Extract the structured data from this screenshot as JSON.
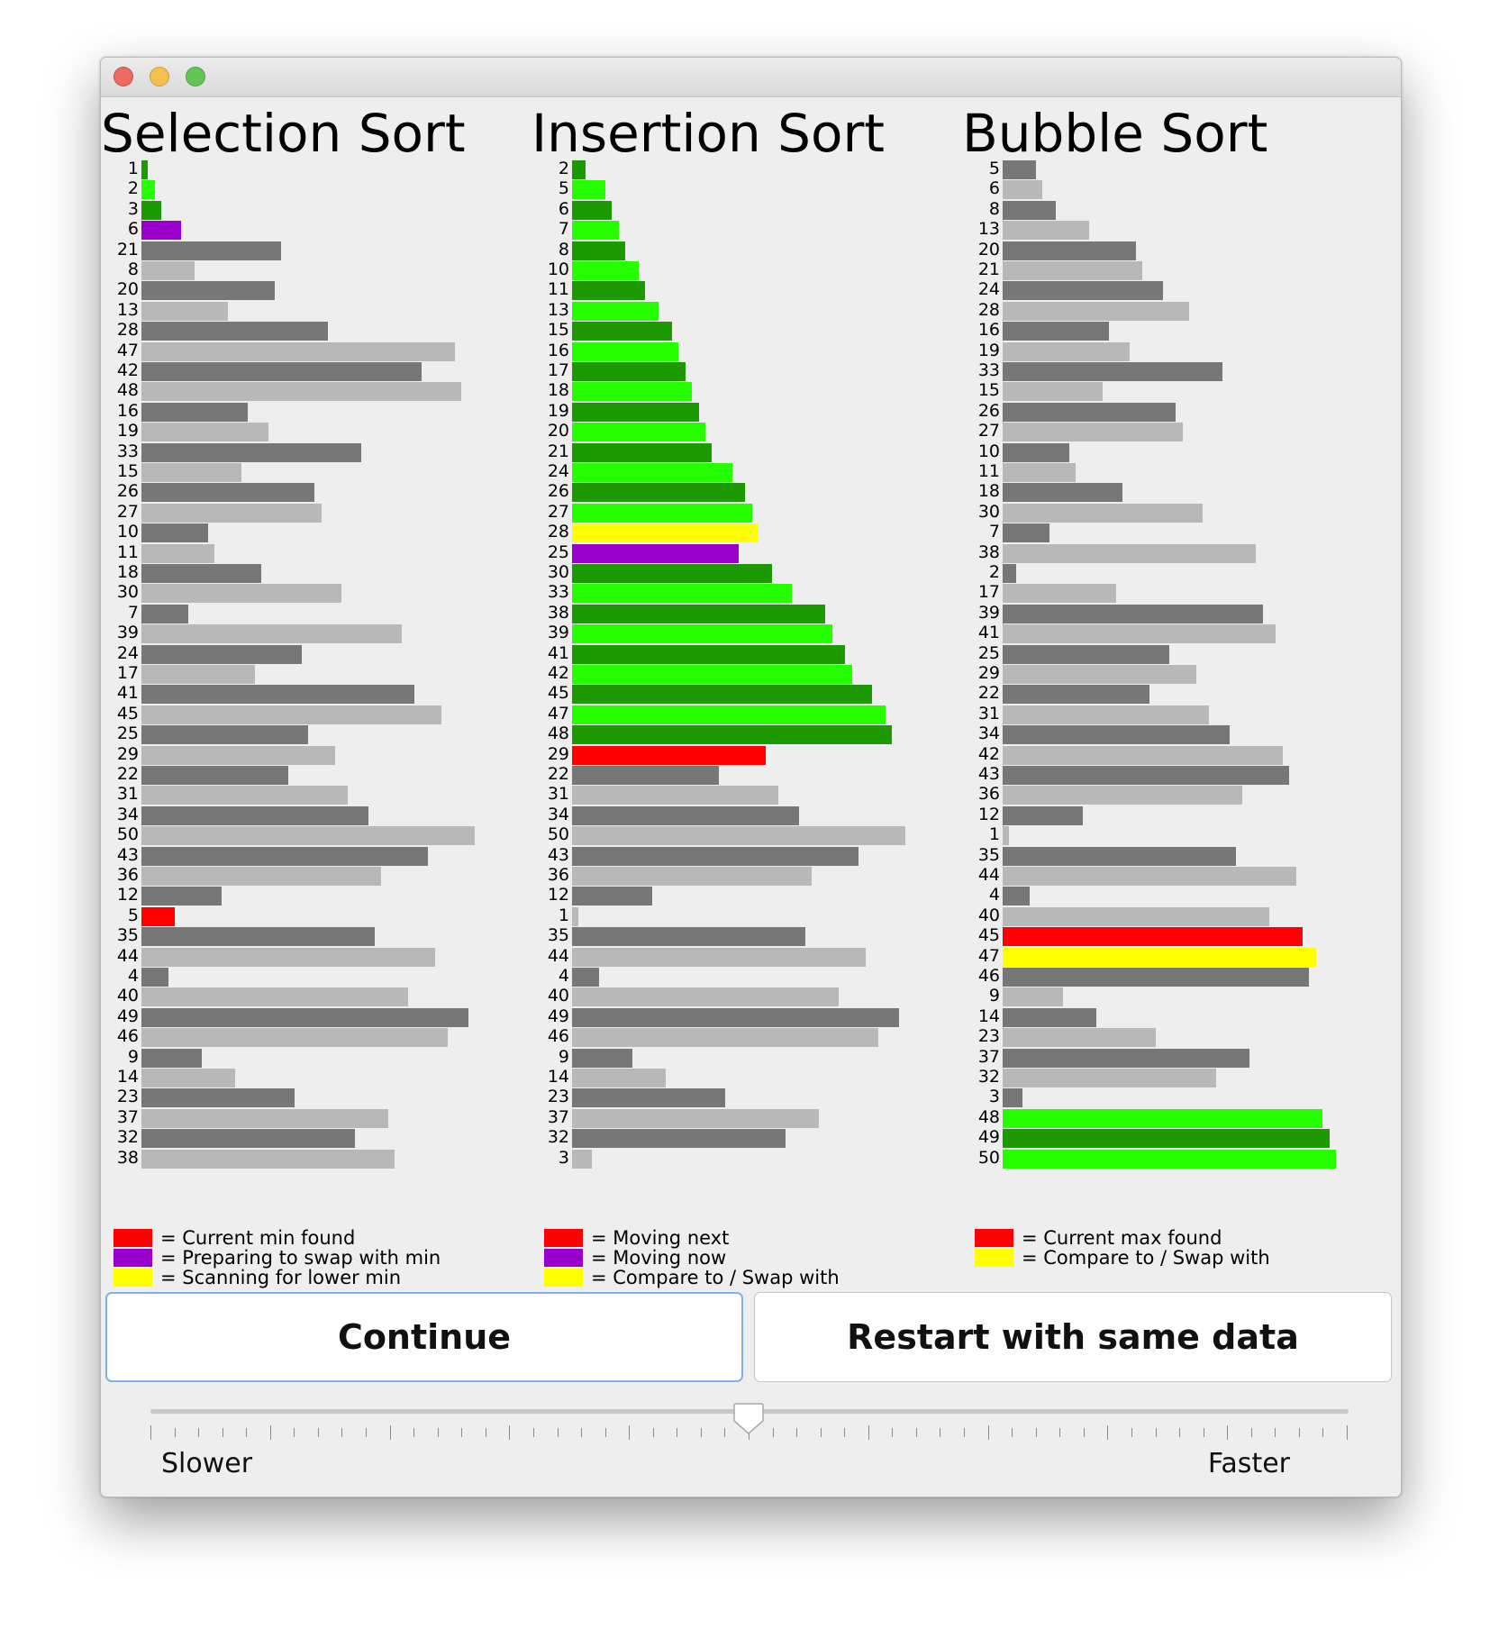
{
  "window": {
    "traffic_lights": [
      {
        "name": "close",
        "color": "#ec6a5f"
      },
      {
        "name": "minimize",
        "color": "#f4bf4f"
      },
      {
        "name": "zoom",
        "color": "#62c655"
      }
    ]
  },
  "colors": {
    "dark": "#777777",
    "light": "#b8b8b8",
    "green_dark": "#1d9a00",
    "green_light": "#26ff00",
    "red": "#ff0000",
    "purple": "#9900cc",
    "yellow": "#ffff00"
  },
  "panels": [
    {
      "title": "Selection Sort",
      "values": [
        1,
        2,
        3,
        6,
        21,
        8,
        20,
        13,
        28,
        47,
        42,
        48,
        16,
        19,
        33,
        15,
        26,
        27,
        10,
        11,
        18,
        30,
        7,
        39,
        24,
        17,
        41,
        45,
        25,
        29,
        22,
        31,
        34,
        50,
        43,
        36,
        12,
        5,
        35,
        44,
        4,
        40,
        49,
        46,
        9,
        14,
        23,
        37,
        32,
        38
      ],
      "states": [
        "s",
        "s",
        "s",
        "p",
        "n",
        "n",
        "n",
        "n",
        "n",
        "n",
        "n",
        "n",
        "n",
        "n",
        "n",
        "n",
        "n",
        "n",
        "n",
        "n",
        "n",
        "n",
        "n",
        "n",
        "n",
        "n",
        "n",
        "n",
        "n",
        "n",
        "n",
        "n",
        "n",
        "n",
        "n",
        "n",
        "n",
        "r",
        "n",
        "n",
        "n",
        "n",
        "n",
        "n",
        "n",
        "n",
        "n",
        "n",
        "n",
        "n"
      ],
      "legend": [
        {
          "color": "#ff0000",
          "text": "= Current min found"
        },
        {
          "color": "#9900cc",
          "text": "= Preparing to swap with min"
        },
        {
          "color": "#ffff00",
          "text": "= Scanning for lower min"
        }
      ]
    },
    {
      "title": "Insertion Sort",
      "values": [
        2,
        5,
        6,
        7,
        8,
        10,
        11,
        13,
        15,
        16,
        17,
        18,
        19,
        20,
        21,
        24,
        26,
        27,
        28,
        25,
        30,
        33,
        38,
        39,
        41,
        42,
        45,
        47,
        48,
        29,
        22,
        31,
        34,
        50,
        43,
        36,
        12,
        1,
        35,
        44,
        4,
        40,
        49,
        46,
        9,
        14,
        23,
        37,
        32,
        3
      ],
      "states": [
        "s",
        "s",
        "s",
        "s",
        "s",
        "s",
        "s",
        "s",
        "s",
        "s",
        "s",
        "s",
        "s",
        "s",
        "s",
        "s",
        "s",
        "s",
        "y",
        "p",
        "s",
        "s",
        "s",
        "s",
        "s",
        "s",
        "s",
        "s",
        "s",
        "r",
        "n",
        "n",
        "n",
        "n",
        "n",
        "n",
        "n",
        "n",
        "n",
        "n",
        "n",
        "n",
        "n",
        "n",
        "n",
        "n",
        "n",
        "n",
        "n",
        "n"
      ],
      "legend": [
        {
          "color": "#ff0000",
          "text": "= Moving next"
        },
        {
          "color": "#9900cc",
          "text": "= Moving now"
        },
        {
          "color": "#ffff00",
          "text": "= Compare to / Swap with"
        }
      ]
    },
    {
      "title": "Bubble Sort",
      "values": [
        5,
        6,
        8,
        13,
        20,
        21,
        24,
        28,
        16,
        19,
        33,
        15,
        26,
        27,
        10,
        11,
        18,
        30,
        7,
        38,
        2,
        17,
        39,
        41,
        25,
        29,
        22,
        31,
        34,
        42,
        43,
        36,
        12,
        1,
        35,
        44,
        4,
        40,
        45,
        47,
        46,
        9,
        14,
        23,
        37,
        32,
        3,
        48,
        49,
        50
      ],
      "states": [
        "n",
        "n",
        "n",
        "n",
        "n",
        "n",
        "n",
        "n",
        "n",
        "n",
        "n",
        "n",
        "n",
        "n",
        "n",
        "n",
        "n",
        "n",
        "n",
        "n",
        "n",
        "n",
        "n",
        "n",
        "n",
        "n",
        "n",
        "n",
        "n",
        "n",
        "n",
        "n",
        "n",
        "n",
        "n",
        "n",
        "n",
        "n",
        "r",
        "y",
        "n",
        "n",
        "n",
        "n",
        "n",
        "n",
        "n",
        "s",
        "s",
        "s"
      ],
      "legend": [
        {
          "color": "#ff0000",
          "text": "= Current max found"
        },
        {
          "color": "#ffff00",
          "text": "= Compare to / Swap with"
        }
      ]
    }
  ],
  "buttons": {
    "continue": "Continue",
    "restart": "Restart with same data"
  },
  "speed": {
    "position": 0.5,
    "tick_count": 51,
    "min_label": "Slower",
    "max_label": "Faster"
  }
}
